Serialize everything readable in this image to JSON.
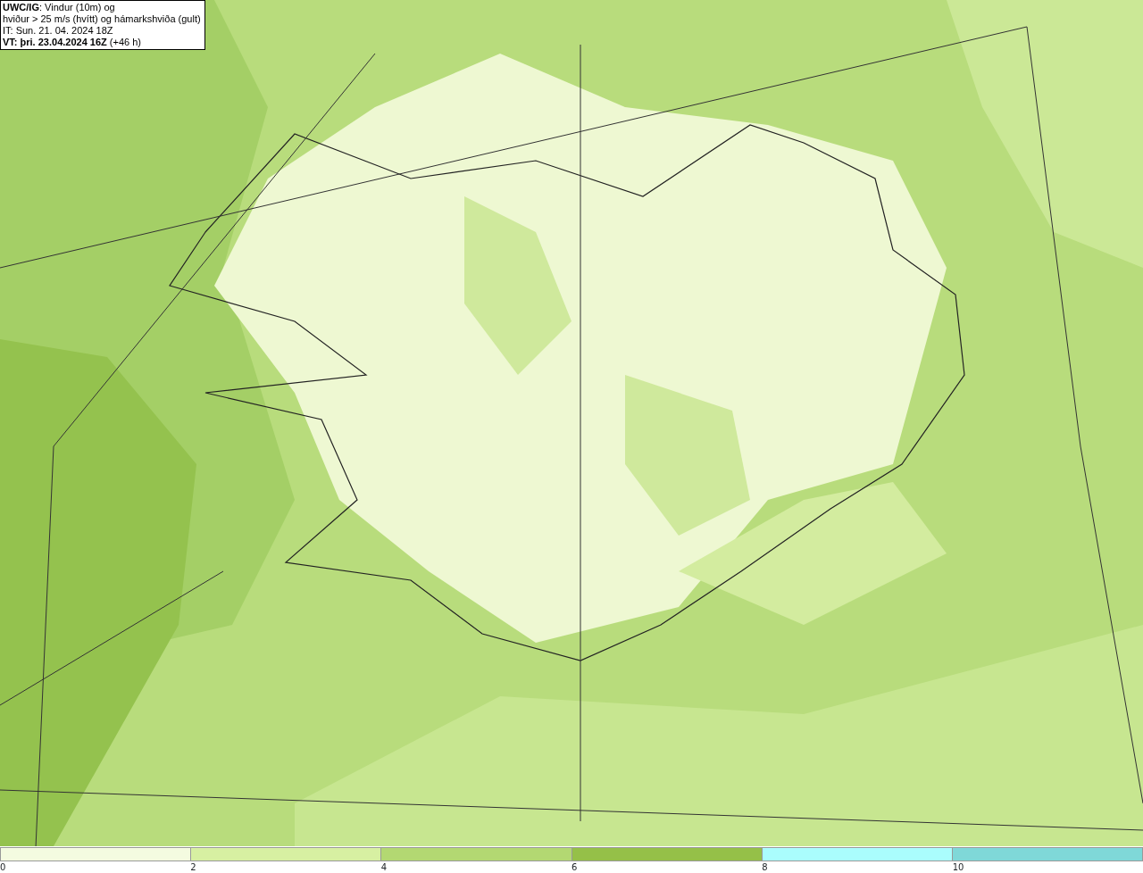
{
  "title_box": {
    "lines": [
      "**UWC/IG**: Vindur (10m) og",
      "hviður > 25 m/s (hvítt) og hámarkshviða (gult)",
      "IT: Sun. 21. 04. 2024 18Z",
      "**VT: þri. 23.04.2024 16Z** (+46 h)"
    ]
  },
  "legend": {
    "segments": [
      {
        "color": "#f4fbe0"
      },
      {
        "color": "#d7f0a2"
      },
      {
        "color": "#b3d872"
      },
      {
        "color": "#95c048"
      },
      {
        "color": "#aafdfd"
      },
      {
        "color": "#7fd8d8"
      }
    ],
    "ticks": [
      "0",
      "2",
      "4",
      "6",
      "8",
      "10"
    ]
  }
}
